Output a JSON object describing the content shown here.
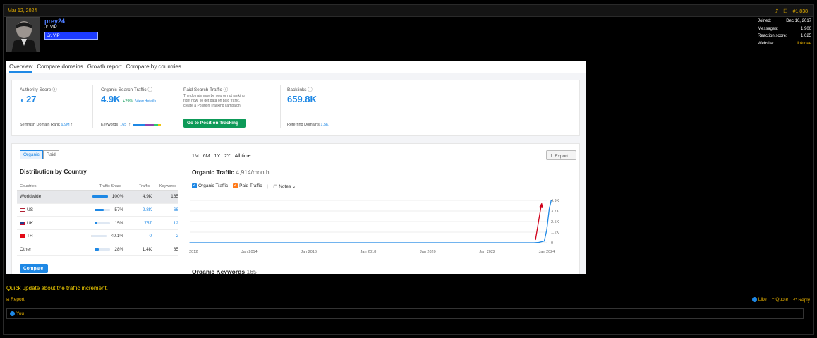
{
  "post": {
    "date": "Mar 12, 2024",
    "number": "#1,838",
    "text": "Quick update about the traffic increment.",
    "report_label": "Report",
    "like_label": "Like",
    "quote_label": "+ Quote",
    "reply_label": "Reply",
    "liked_by": "You"
  },
  "user": {
    "name": "prey24",
    "title": "Jr. VIP",
    "badge": "Jr. VIP",
    "stats": [
      {
        "label": "Joined:",
        "value": "Dec 16, 2017"
      },
      {
        "label": "Messages:",
        "value": "1,900"
      },
      {
        "label": "Reaction score:",
        "value": "1,625"
      },
      {
        "label": "Website:",
        "value": "linktr.ee"
      }
    ]
  },
  "semrush": {
    "tabs": [
      "Overview",
      "Compare domains",
      "Growth report",
      "Compare by countries"
    ],
    "authority": {
      "label": "Authority Score",
      "value": "27",
      "foot_label": "Semrush Domain Rank",
      "foot_value": "6.9M"
    },
    "organic": {
      "label": "Organic Search Traffic",
      "value": "4.9K",
      "change": "+29%",
      "link": "View details",
      "foot_label": "Keywords",
      "foot_value": "165"
    },
    "paid": {
      "label": "Paid Search Traffic",
      "note": "The domain may be new or not ranking right now. To get data on paid traffic, create a Position Tracking campaign.",
      "button": "Go to Position Tracking"
    },
    "backlinks": {
      "label": "Backlinks",
      "value": "659.8K",
      "foot_label": "Referring Domains",
      "foot_value": "1.5K"
    },
    "toggle": [
      "Organic",
      "Paid"
    ],
    "distribution_title": "Distribution by Country",
    "table_headers": [
      "Countries",
      "Traffic Share",
      "Traffic",
      "Keywords"
    ],
    "countries": [
      {
        "name": "Worldwide",
        "share": "100%",
        "share_frac": 1.0,
        "traffic": "4.9K",
        "keywords": "165"
      },
      {
        "name": "US",
        "share": "57%",
        "share_frac": 0.57,
        "traffic": "2.8K",
        "keywords": "66"
      },
      {
        "name": "UK",
        "share": "15%",
        "share_frac": 0.15,
        "traffic": "757",
        "keywords": "12"
      },
      {
        "name": "TR",
        "share": "<0.1%",
        "share_frac": 0.0,
        "traffic": "0",
        "keywords": "2"
      },
      {
        "name": "Other",
        "share": "28%",
        "share_frac": 0.28,
        "traffic": "1.4K",
        "keywords": "85"
      }
    ],
    "compare_button": "Compare",
    "ranges": [
      "1M",
      "6M",
      "1Y",
      "2Y",
      "All time"
    ],
    "selected_range": "All time",
    "export_label": "Export",
    "traffic_title": "Organic Traffic",
    "traffic_value": "4,914/month",
    "legend": [
      "Organic Traffic",
      "Paid Traffic",
      "Notes"
    ],
    "keywords_title": "Organic Keywords",
    "keywords_value": "165",
    "colors": {
      "accent": "#1e88e5",
      "green": "#0d9a58",
      "paid": "#ff7a1a"
    }
  },
  "chart_data": {
    "type": "line",
    "title": "Organic Traffic",
    "x_ticks": [
      "Jan 2012",
      "Jan 2014",
      "Jan 2016",
      "Jan 2018",
      "Jan 2020",
      "Jan 2022",
      "Jan 2024"
    ],
    "y_ticks": [
      "0",
      "1.2K",
      "2.5K",
      "3.7K",
      "4.9K"
    ],
    "ylim": [
      0,
      4900
    ],
    "series": [
      {
        "name": "Organic Traffic",
        "x": [
          "2012-01",
          "2023-08",
          "2023-10",
          "2023-12",
          "2024-01",
          "2024-02",
          "2024-03"
        ],
        "y": [
          0,
          0,
          50,
          200,
          1500,
          3900,
          4914
        ]
      }
    ]
  }
}
